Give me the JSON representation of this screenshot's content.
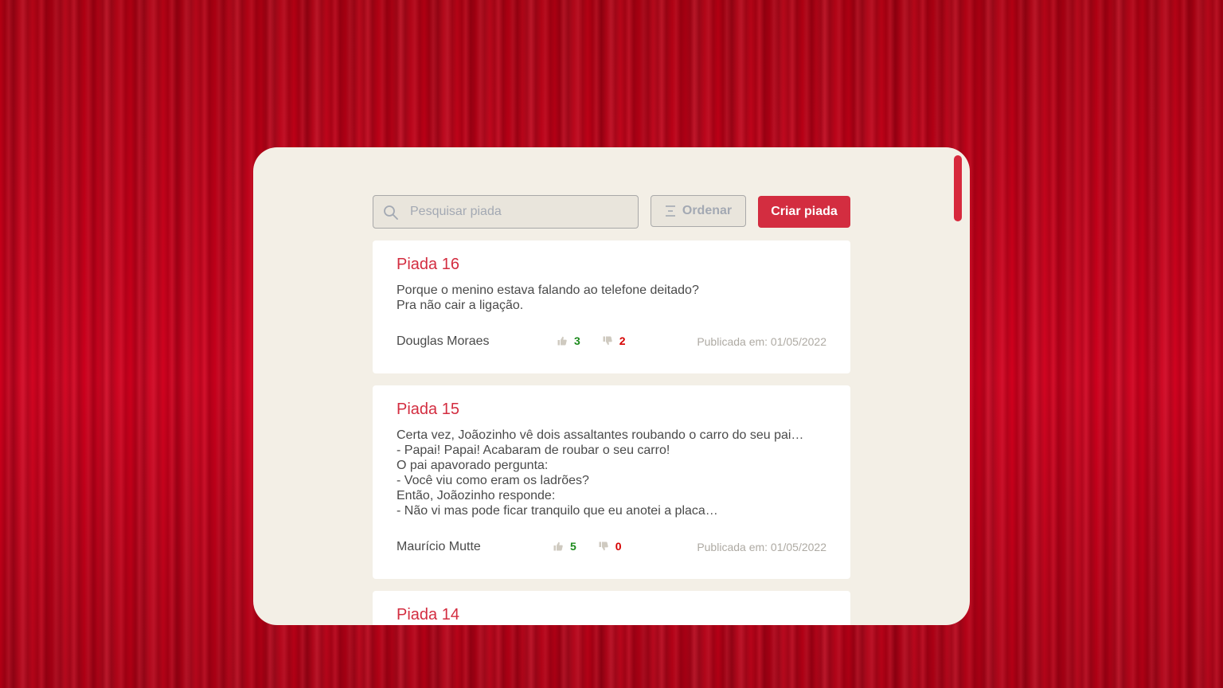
{
  "search": {
    "placeholder": "Pesquisar piada",
    "value": ""
  },
  "toolbar": {
    "sort_label": "Ordenar",
    "create_label": "Criar piada"
  },
  "jokes": [
    {
      "title": "Piada 16",
      "lines": [
        "Porque o menino estava falando ao telefone deitado?",
        "Pra não cair a ligação."
      ],
      "author": "Douglas Moraes",
      "likes": "3",
      "dislikes": "2",
      "published": "Publicada em: 01/05/2022"
    },
    {
      "title": "Piada 15",
      "lines": [
        "Certa vez, Joãozinho vê dois assaltantes roubando o carro do seu pai…",
        "- Papai! Papai! Acabaram de roubar o seu carro!",
        "O pai apavorado pergunta:",
        "- Você viu como eram os ladrões?",
        "Então, Joãozinho responde:",
        "- Não vi mas pode ficar tranquilo que eu anotei a placa…"
      ],
      "author": "Maurício Mutte",
      "likes": "5",
      "dislikes": "0",
      "published": "Publicada em: 01/05/2022"
    },
    {
      "title": "Piada 14"
    }
  ],
  "colors": {
    "accent": "#d32d40",
    "panel": "#f3efe6",
    "like": "#1c8a1c",
    "dislike": "#d60000"
  },
  "icons": {
    "search": "search-icon",
    "sort": "sort-icon",
    "like": "thumbs-up-icon",
    "dislike": "thumbs-down-icon"
  }
}
